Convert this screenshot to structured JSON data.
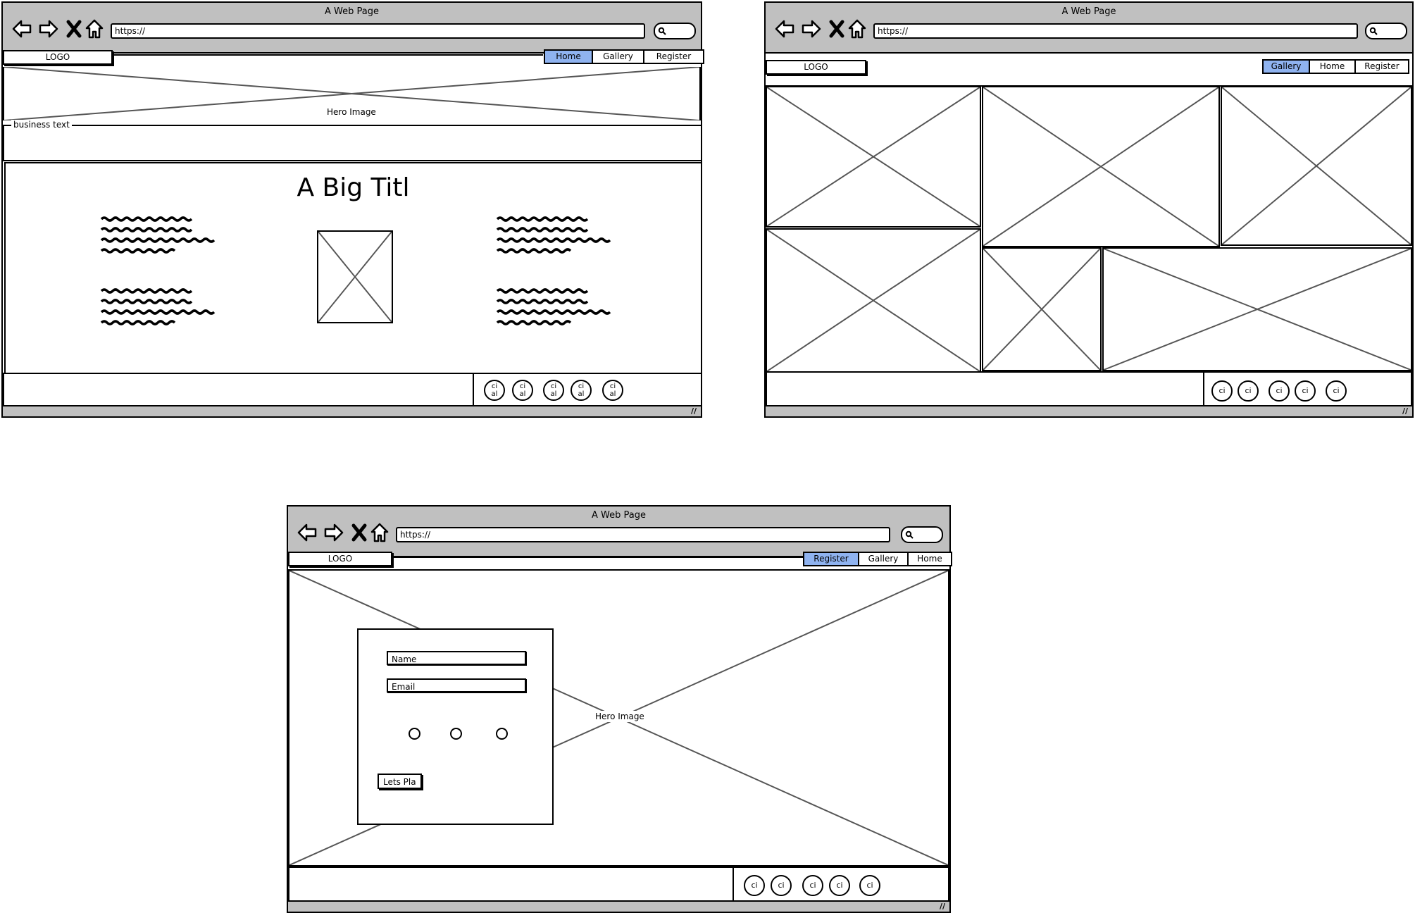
{
  "window_title": "A Web Page",
  "url_text": "https://",
  "logo_text": "LOGO",
  "home_page": {
    "menu": [
      "Home",
      "Gallery",
      "Register"
    ],
    "active_menu": "Home",
    "hero_label": "Hero Image",
    "business_text_label": "business text",
    "big_title": "A Big Titl",
    "social_labels": [
      "ci\nal",
      "ci\nal",
      "ci\nal",
      "ci\nal",
      "ci\nal"
    ]
  },
  "gallery_page": {
    "menu": [
      "Gallery",
      "Home",
      "Register"
    ],
    "active_menu": "Gallery",
    "social_labels": [
      "ci",
      "ci",
      "ci",
      "ci",
      "ci"
    ]
  },
  "register_page": {
    "menu": [
      "Register",
      "Gallery",
      "Home"
    ],
    "active_menu": "Register",
    "hero_label": "Hero Image",
    "form": {
      "name_field": "Name",
      "email_field": "Email",
      "radio_count": 3,
      "submit_label": "Lets Pla"
    },
    "social_labels": [
      "ci",
      "ci",
      "ci",
      "ci",
      "ci"
    ]
  },
  "colors": {
    "chrome_gray": "#c0c0c0",
    "active_tab_blue": "#8fb3f0",
    "placeholder_line": "#555555"
  }
}
